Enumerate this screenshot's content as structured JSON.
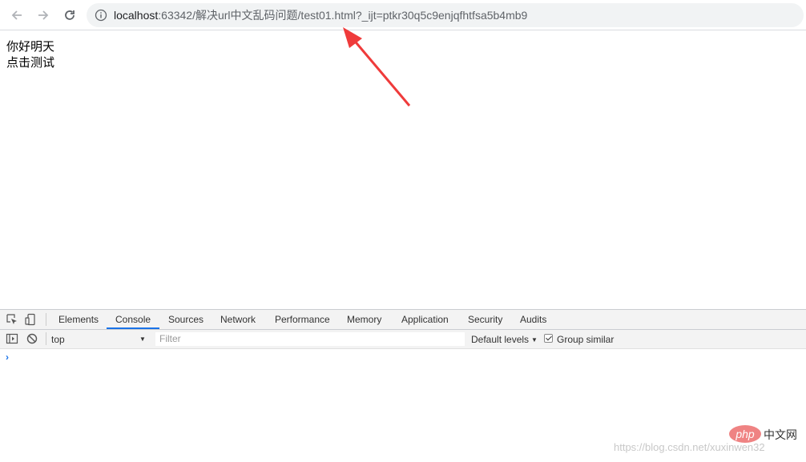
{
  "browser": {
    "url_host": "localhost",
    "url_rest": ":63342/解决url中文乱码问题/test01.html?_ijt=ptkr30q5c9enjqfhtfsa5b4mb9"
  },
  "page": {
    "lines": [
      "你好明天",
      "点击测试"
    ]
  },
  "devtools": {
    "tabs": [
      "Elements",
      "Console",
      "Sources",
      "Network",
      "Performance",
      "Memory",
      "Application",
      "Security",
      "Audits"
    ],
    "active_tab": "Console",
    "context": "top",
    "filter_placeholder": "Filter",
    "levels": "Default levels",
    "group_similar": "Group similar",
    "group_similar_checked": true,
    "prompt": "›"
  },
  "watermark": {
    "logo": "php",
    "logo_suffix": "中文网",
    "url": "https://blog.csdn.net/xuxinwen32"
  },
  "colors": {
    "accent": "#1a73e8",
    "annotation_arrow": "#ef3b3b"
  }
}
